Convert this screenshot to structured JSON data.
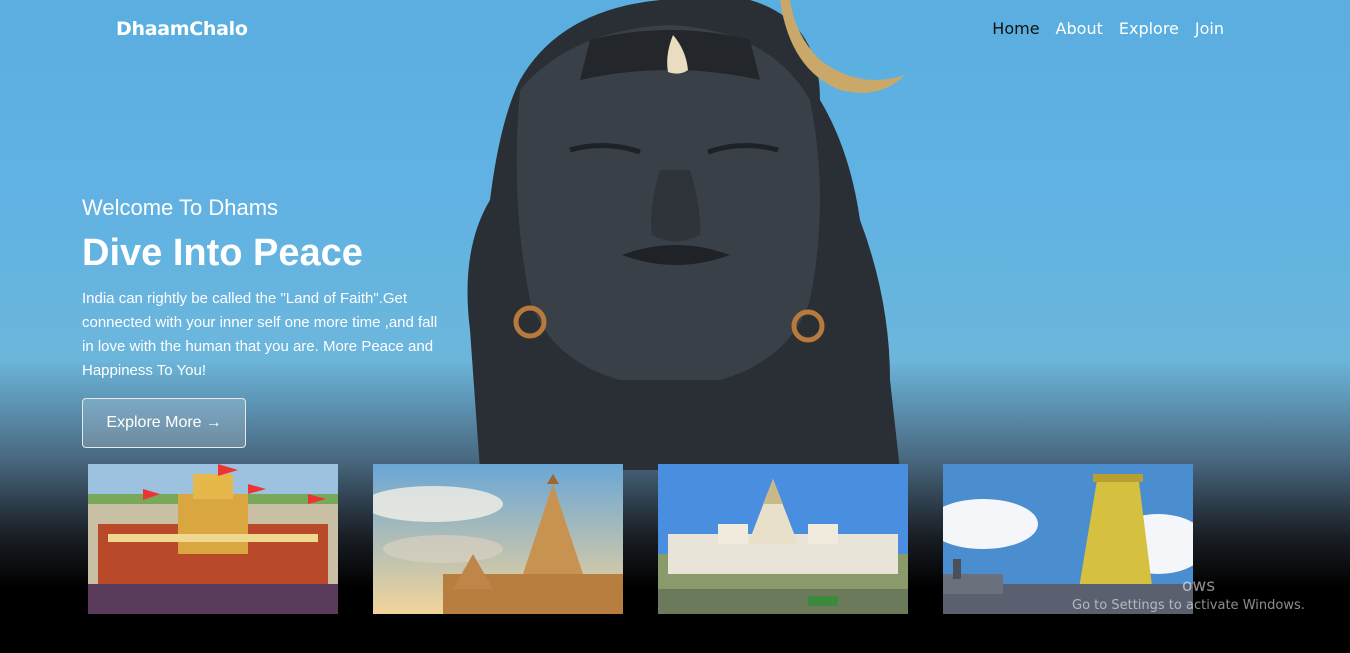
{
  "nav": {
    "brand": "DhaamChalo",
    "links": [
      "Home",
      "About",
      "Explore",
      "Join"
    ]
  },
  "hero": {
    "welcome": "Welcome To Dhams",
    "headline": "Dive Into Peace",
    "description": "India can rightly be called the \"Land of Faith\".Get connected with your inner self one more time ,and fall in love with the human that you are. More Peace and Happiness To You!",
    "cta_label": "Explore More",
    "cta_icon": "arrow-right-icon"
  },
  "cards": [
    {
      "name": "badrinath-temple-card"
    },
    {
      "name": "somnath-temple-card"
    },
    {
      "name": "jagannath-puri-temple-card"
    },
    {
      "name": "rameshwaram-temple-card"
    }
  ],
  "watermark": {
    "title": "ows",
    "subtitle": "Go to Settings to activate Windows."
  },
  "colors": {
    "sky": "#62b3e2",
    "nav_active": "#111111",
    "text": "#ffffff"
  }
}
